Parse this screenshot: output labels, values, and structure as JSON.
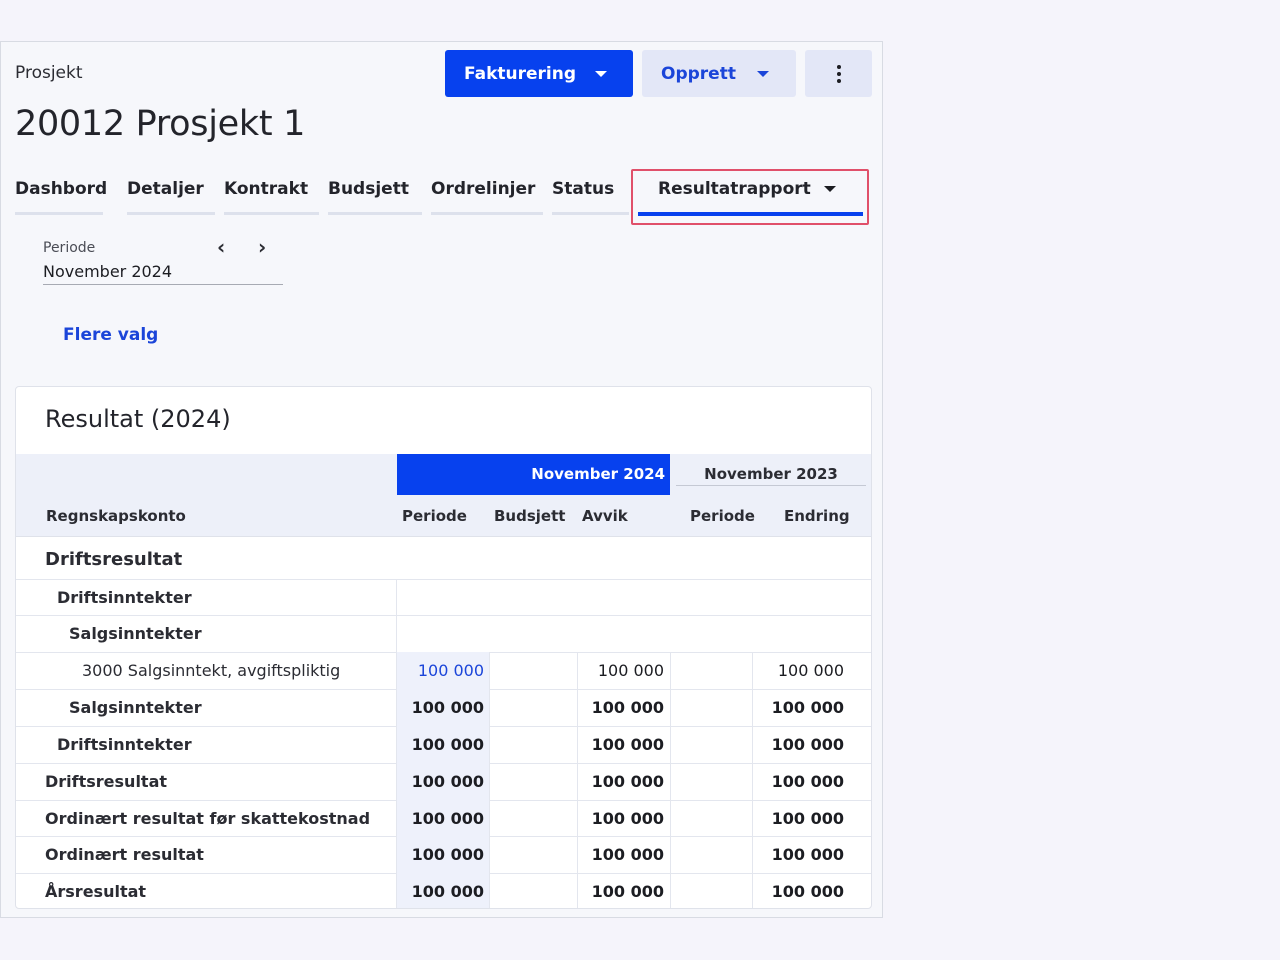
{
  "header": {
    "breadcrumb": "Prosjekt",
    "title": "20012 Prosjekt 1",
    "primary_button": "Fakturering",
    "secondary_button": "Opprett",
    "more_icon": "kebab-menu-icon"
  },
  "tabs": [
    {
      "label": "Dashbord"
    },
    {
      "label": "Detaljer"
    },
    {
      "label": "Kontrakt"
    },
    {
      "label": "Budsjett"
    },
    {
      "label": "Ordrelinjer"
    },
    {
      "label": "Status"
    },
    {
      "label": "Resultatrapport",
      "active": true
    }
  ],
  "period": {
    "label": "Periode",
    "value": "November 2024",
    "prev_icon": "chevron-left-icon",
    "next_icon": "chevron-right-icon"
  },
  "more_options": "Flere valg",
  "report": {
    "title": "Resultat (2024)",
    "group_current": "November 2024",
    "group_previous": "November 2023",
    "col_account": "Regnskapskonto",
    "col_period": "Periode",
    "col_budget": "Budsjett",
    "col_diff": "Avvik",
    "col_prev_period": "Periode",
    "col_change": "Endring",
    "rows": [
      {
        "label": "Driftsresultat",
        "level": 0,
        "type": "section"
      },
      {
        "label": "Driftsinntekter",
        "level": 1,
        "type": "group"
      },
      {
        "label": "Salgsinntekter",
        "level": 2,
        "type": "group"
      },
      {
        "label": "3000 Salgsinntekt, avgiftspliktig",
        "level": 3,
        "type": "account",
        "period": "100 000",
        "budget": "",
        "diff": "100 000",
        "prev": "",
        "change": "100 000"
      },
      {
        "label": "Salgsinntekter",
        "level": 2,
        "type": "sum",
        "period": "100 000",
        "budget": "",
        "diff": "100 000",
        "prev": "",
        "change": "100 000"
      },
      {
        "label": "Driftsinntekter",
        "level": 1,
        "type": "sum",
        "period": "100 000",
        "budget": "",
        "diff": "100 000",
        "prev": "",
        "change": "100 000"
      },
      {
        "label": "Driftsresultat",
        "level": 0,
        "type": "sum",
        "period": "100 000",
        "budget": "",
        "diff": "100 000",
        "prev": "",
        "change": "100 000"
      },
      {
        "label": "Ordinært resultat før skattekostnad",
        "level": 0,
        "type": "sum",
        "period": "100 000",
        "budget": "",
        "diff": "100 000",
        "prev": "",
        "change": "100 000"
      },
      {
        "label": "Ordinært resultat",
        "level": 0,
        "type": "sum",
        "period": "100 000",
        "budget": "",
        "diff": "100 000",
        "prev": "",
        "change": "100 000"
      },
      {
        "label": "Årsresultat",
        "level": 0,
        "type": "sum",
        "period": "100 000",
        "budget": "",
        "diff": "100 000",
        "prev": "",
        "change": "100 000"
      }
    ]
  },
  "colors": {
    "accent": "#0741ee",
    "link": "#1b45d9",
    "highlight_border": "#e0506a"
  }
}
